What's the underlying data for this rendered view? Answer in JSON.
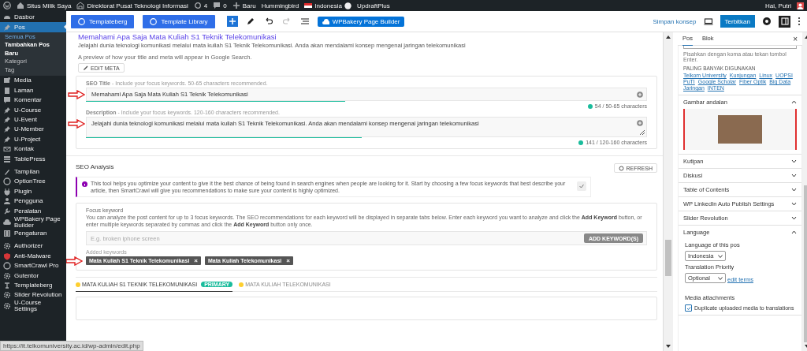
{
  "admin_bar": {
    "items": [
      {
        "kind": "wp-logo"
      },
      {
        "kind": "home",
        "label": "Situs Milik Saya"
      },
      {
        "kind": "building",
        "label": "Direktorat Pusat Teknologi Informasi"
      },
      {
        "kind": "updates",
        "label": "4"
      },
      {
        "kind": "comments",
        "label": "0"
      },
      {
        "kind": "plus",
        "label": "Baru"
      },
      {
        "kind": "text",
        "label": "Hummingbird"
      },
      {
        "kind": "flag",
        "label": "Indonesia"
      },
      {
        "kind": "text",
        "label": "UpdraftPlus"
      }
    ],
    "greeting": "Hai, Putri"
  },
  "sidebar": {
    "groups": [
      [
        {
          "kind": "gauge",
          "label": "Dasbor",
          "current": false
        },
        {
          "kind": "pin",
          "label": "Pos",
          "current": true,
          "children": [
            {
              "label": "Semua Pos",
              "selected": false,
              "hovered": true
            },
            {
              "label": "Tambahkan Pos Baru",
              "selected": true,
              "hovered": false
            },
            {
              "label": "Kategori",
              "selected": false,
              "hovered": false
            },
            {
              "label": "Tag",
              "selected": false,
              "hovered": false
            }
          ]
        },
        {
          "kind": "media",
          "label": "Media",
          "current": false
        },
        {
          "kind": "page",
          "label": "Laman",
          "current": false
        },
        {
          "kind": "comment",
          "label": "Komentar",
          "current": false
        },
        {
          "kind": "pin",
          "label": "U-Course",
          "current": false
        },
        {
          "kind": "pin",
          "label": "U-Event",
          "current": false
        },
        {
          "kind": "pin",
          "label": "U-Member",
          "current": false
        },
        {
          "kind": "pin",
          "label": "U-Project",
          "current": false
        },
        {
          "kind": "mail",
          "label": "Kontak",
          "current": false
        },
        {
          "kind": "table",
          "label": "TablePress",
          "current": false
        }
      ],
      [
        {
          "kind": "brush",
          "label": "Tampilan",
          "current": false
        },
        {
          "kind": "circle",
          "label": "OptionTree",
          "current": false
        },
        {
          "kind": "plug",
          "label": "Plugin",
          "current": false
        },
        {
          "kind": "person",
          "label": "Pengguna",
          "current": false
        },
        {
          "kind": "wrench",
          "label": "Peralatan",
          "current": false
        },
        {
          "kind": "cloud",
          "label": "WPBakery Page Builder",
          "current": false
        },
        {
          "kind": "sliders",
          "label": "Pengaturan",
          "current": false
        }
      ],
      [
        {
          "kind": "gear",
          "label": "Authorizer",
          "current": false
        },
        {
          "kind": "shield",
          "label": "Anti-Malware",
          "current": false
        },
        {
          "kind": "circle",
          "label": "SmartCrawl Pro",
          "current": false
        },
        {
          "kind": "gear",
          "label": "Gutentor",
          "current": false
        },
        {
          "kind": "letter",
          "label": "Templateberg",
          "current": false
        },
        {
          "kind": "gear",
          "label": "Slider Revolution",
          "current": false
        },
        {
          "kind": "gear",
          "label": "U-Course Settings",
          "current": false
        }
      ]
    ]
  },
  "editor_toolbar": {
    "left": [
      {
        "kind": "brand-button",
        "label": "Templateberg"
      },
      {
        "kind": "brand-button",
        "label": "Template Library"
      },
      {
        "kind": "add"
      },
      {
        "kind": "pen"
      },
      {
        "kind": "undo"
      },
      {
        "kind": "redo"
      },
      {
        "kind": "outline"
      },
      {
        "kind": "builder-button",
        "label": "WPBakery Page Builder"
      }
    ],
    "save_draft": "Simpan konsep",
    "publish": "Terbitkan",
    "settings_open": true
  },
  "snippet_preview": {
    "title": "Memahami Apa Saja Mata Kuliah S1 Teknik Telekomunikasi",
    "description": "Jelajahi dunia teknologi komunikasi melalui mata kuliah S1 Teknik Telekomunikasi. Anda akan mendalami konsep mengenai jaringan telekomunikasi",
    "caption": "A preview of how your title and meta will appear in Google Search.",
    "edit_button": "EDIT META"
  },
  "meta_fields": [
    {
      "kind": "line",
      "label": "SEO Title",
      "hint": "- Include your focus keywords. 50-65 characters recommended.",
      "value": "Memahami Apa Saja Mata Kuliah S1 Teknik Telekomunikasi",
      "level": 0.47,
      "count": "54 / 50-65 characters",
      "annotated": true
    },
    {
      "kind": "area",
      "label": "Description",
      "hint": "- Include your focus keywords. 120-160 characters recommended.",
      "value": "Jelajahi dunia teknologi komunikasi melalui mata kuliah S1 Teknik Telekomunikasi. Anda akan mendalami konsep mengenai  jaringan telekomunikasi",
      "level": 0.5,
      "count": "141 / 120-160 characters",
      "annotated": true
    }
  ],
  "seo_analysis": {
    "title": "SEO Analysis",
    "refresh": "REFRESH",
    "notice": "This tool helps you optimize your content to give it the best chance of being found in search engines when people are looking for it. Start by choosing a few focus keywords that best describe your article, then SmartCrawl will give you recommendations to make sure your content is highly optimized.",
    "focus_keyword": {
      "label": "Focus keyword",
      "description": "You can analyze the post content for up to 3 focus keywords. The SEO recommendations for each keyword will be displayed in separate tabs below. Enter each keyword you want to analyze and click the **Add Keyword** button, or enter multiple keywords separated by commas and click the **Add Keyword** button only once.",
      "placeholder": "E.g. broken iphone screen",
      "button": "ADD KEYWORD(S)",
      "added_label": "Added keywords",
      "keywords": [
        {
          "text": "Mata Kuliah S1 Teknik Telekomunikasi",
          "remove": "×",
          "annotated": true
        },
        {
          "text": "Mata Kuliah Telekomunikasi",
          "remove": "×",
          "annotated": false
        }
      ]
    },
    "tabs": [
      {
        "label": "MATA KULIAH S1 TEKNIK TELEKOMUNIKASI",
        "badge": "PRIMARY",
        "selected": true
      },
      {
        "label": "MATA KULIAH TELEKOMUNIKASI",
        "selected": false
      }
    ]
  },
  "settings_panel": {
    "tabs": [
      {
        "label": "Pos",
        "selected": true
      },
      {
        "label": "Blok",
        "selected": false
      }
    ],
    "close": "×",
    "tags": {
      "hint": "Pisahkan dengan koma atau tekan tombol Enter.",
      "most_used_label": "PALING BANYAK DIGUNAKAN",
      "most_used": [
        "Telkom University",
        "Kunjungan",
        "Linux",
        "UOPSI",
        "PuTI",
        "Google Scholar",
        "Fiber Optik",
        "Big Data",
        "Jaringan",
        "INTEN"
      ]
    },
    "sections": [
      {
        "kind": "image",
        "title": "Gambar andalan",
        "expanded": true
      },
      {
        "title": "Kutipan",
        "expanded": false
      },
      {
        "title": "Diskusi",
        "expanded": false
      },
      {
        "title": "Table of Contents",
        "expanded": false
      },
      {
        "title": "WP LinkedIn Auto Publish Settings",
        "expanded": false
      },
      {
        "title": "Slider Revolution",
        "expanded": false
      },
      {
        "kind": "language",
        "title": "Language",
        "expanded": true,
        "language_label": "Language of this pos",
        "language": "Indonesia",
        "priority_label": "Translation Priority",
        "priority": "Optional",
        "edit_link": "edit terms",
        "media_label": "Media attachments",
        "duplicate_label": "Duplicate uploaded media to translations",
        "duplicate_checked": true
      }
    ]
  },
  "status_url": "https://it.telkomuniversity.ac.id/wp-admin/edit.php"
}
